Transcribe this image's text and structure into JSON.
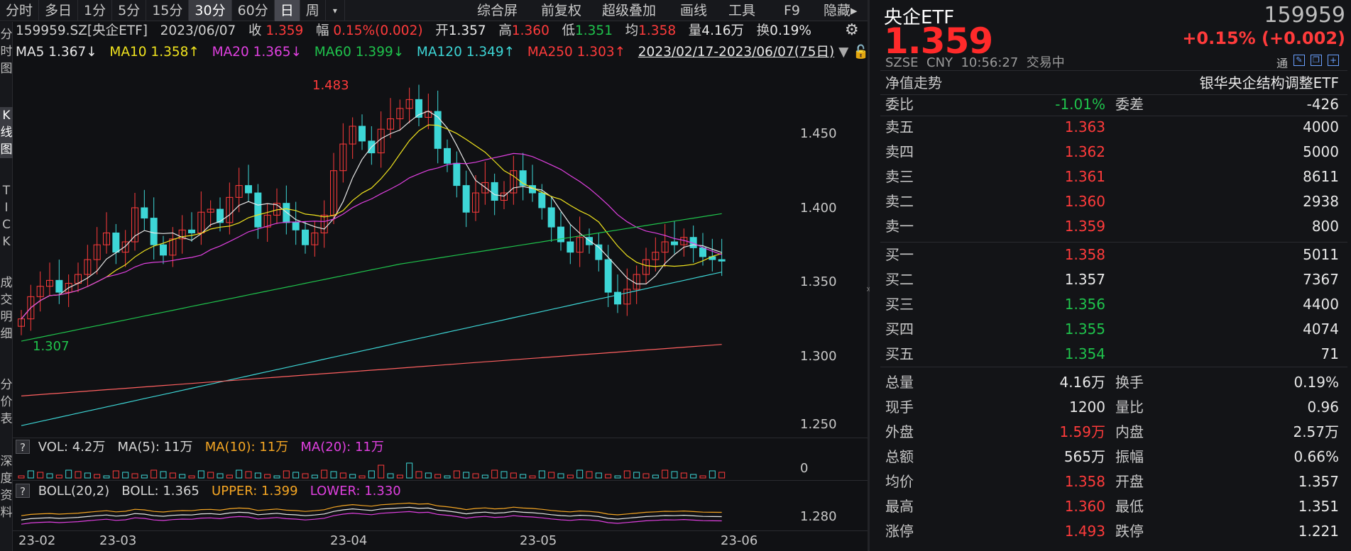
{
  "toolbar": {
    "tabs": [
      "分时",
      "多日",
      "1分",
      "5分",
      "15分",
      "30分",
      "60分",
      "日",
      "周",
      "▾"
    ],
    "right": [
      "综合屏",
      "前复权",
      "超级叠加",
      "画线",
      "工具",
      "F9",
      "隐藏▸"
    ]
  },
  "side": [
    "分\n时\n图",
    "K\n线\n图",
    "T\nI\nC\nK",
    "成\n交\n明\n细",
    "分\n价\n表",
    "深\n度\n资\n料"
  ],
  "info": {
    "code": "159959.SZ[央企ETF]",
    "date": "2023/06/07",
    "close_l": "收",
    "close": "1.359",
    "amp_l": "幅",
    "amp": "0.15%(0.002)",
    "open_l": "开",
    "open": "1.357",
    "high_l": "高",
    "high": "1.360",
    "low_l": "低",
    "low": "1.351",
    "avg_l": "均",
    "avg": "1.358",
    "vol_l": "量",
    "vol": "4.16万",
    "turn_l": "换",
    "turn": "0.19%"
  },
  "ma": {
    "ma5": "MA5 1.367↓",
    "ma10": "MA10 1.358↑",
    "ma20": "MA20 1.365↓",
    "ma60": "MA60 1.399↓",
    "ma120": "MA120 1.349↑",
    "ma250": "MA250 1.303↑",
    "range": "2023/02/17-2023/06/07(75日)"
  },
  "yaxis": [
    "1.450",
    "1.400",
    "1.350",
    "1.300",
    "1.250"
  ],
  "annot": {
    "high": "1.483",
    "low": "1.307"
  },
  "vol": {
    "label": "VOL: 4.2万",
    "ma5": "MA(5): 11万",
    "ma10": "MA(10): 11万",
    "ma20": "MA(20): 11万",
    "zero": "0"
  },
  "boll": {
    "label": "BOLL(20,2)",
    "boll": "BOLL: 1.365",
    "upper": "UPPER: 1.399",
    "lower": "LOWER: 1.330",
    "axis": "1.280"
  },
  "xaxis": [
    "23-02",
    "23-03",
    "23-04",
    "23-05",
    "23-06"
  ],
  "quote": {
    "name": "央企ETF",
    "code": "159959",
    "price": "1.359",
    "change": "+0.15% (+0.002)",
    "market": "SZSE  CNY  10:56:27  交易中",
    "tong": "通",
    "nav": "净值走势",
    "fund": "银华央企结构调整ETF",
    "weibi_l": "委比",
    "weibi": "-1.01%",
    "weicha_l": "委差",
    "weicha": "-426",
    "asks": [
      {
        "l": "卖五",
        "p": "1.363",
        "v": "4000"
      },
      {
        "l": "卖四",
        "p": "1.362",
        "v": "5000"
      },
      {
        "l": "卖三",
        "p": "1.361",
        "v": "8611"
      },
      {
        "l": "卖二",
        "p": "1.360",
        "v": "2938"
      },
      {
        "l": "卖一",
        "p": "1.359",
        "v": "800"
      }
    ],
    "bids": [
      {
        "l": "买一",
        "p": "1.358",
        "v": "5011"
      },
      {
        "l": "买二",
        "p": "1.357",
        "v": "7367"
      },
      {
        "l": "买三",
        "p": "1.356",
        "v": "4400"
      },
      {
        "l": "买四",
        "p": "1.355",
        "v": "4074"
      },
      {
        "l": "买五",
        "p": "1.354",
        "v": "71"
      }
    ],
    "stats": [
      {
        "l1": "总量",
        "v1": "4.16万",
        "l2": "换手",
        "v2": "0.19%"
      },
      {
        "l1": "现手",
        "v1": "1200",
        "l2": "量比",
        "v2": "0.96"
      },
      {
        "l1": "外盘",
        "v1": "1.59万",
        "l2": "内盘",
        "v2": "2.57万"
      },
      {
        "l1": "总额",
        "v1": "565万",
        "l2": "振幅",
        "v2": "0.66%"
      },
      {
        "l1": "均价",
        "v1": "1.358",
        "l2": "开盘",
        "v2": "1.357"
      },
      {
        "l1": "最高",
        "v1": "1.360",
        "l2": "最低",
        "v2": "1.351"
      },
      {
        "l1": "涨停",
        "v1": "1.493",
        "l2": "跌停",
        "v2": "1.221"
      }
    ]
  },
  "colors": {
    "up": "#ff3b3b",
    "down": "#3dd6d6",
    "green": "#1fc34c"
  }
}
